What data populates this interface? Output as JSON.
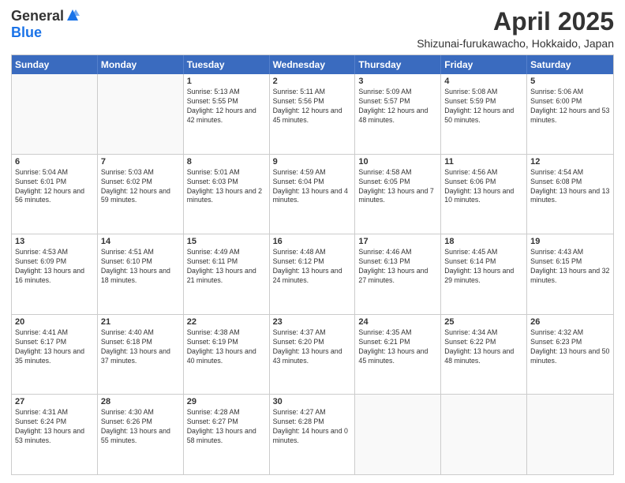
{
  "logo": {
    "general": "General",
    "blue": "Blue"
  },
  "header": {
    "month": "April 2025",
    "location": "Shizunai-furukawacho, Hokkaido, Japan"
  },
  "weekdays": [
    "Sunday",
    "Monday",
    "Tuesday",
    "Wednesday",
    "Thursday",
    "Friday",
    "Saturday"
  ],
  "rows": [
    [
      {
        "day": "",
        "detail": ""
      },
      {
        "day": "",
        "detail": ""
      },
      {
        "day": "1",
        "detail": "Sunrise: 5:13 AM\nSunset: 5:55 PM\nDaylight: 12 hours and 42 minutes."
      },
      {
        "day": "2",
        "detail": "Sunrise: 5:11 AM\nSunset: 5:56 PM\nDaylight: 12 hours and 45 minutes."
      },
      {
        "day": "3",
        "detail": "Sunrise: 5:09 AM\nSunset: 5:57 PM\nDaylight: 12 hours and 48 minutes."
      },
      {
        "day": "4",
        "detail": "Sunrise: 5:08 AM\nSunset: 5:59 PM\nDaylight: 12 hours and 50 minutes."
      },
      {
        "day": "5",
        "detail": "Sunrise: 5:06 AM\nSunset: 6:00 PM\nDaylight: 12 hours and 53 minutes."
      }
    ],
    [
      {
        "day": "6",
        "detail": "Sunrise: 5:04 AM\nSunset: 6:01 PM\nDaylight: 12 hours and 56 minutes."
      },
      {
        "day": "7",
        "detail": "Sunrise: 5:03 AM\nSunset: 6:02 PM\nDaylight: 12 hours and 59 minutes."
      },
      {
        "day": "8",
        "detail": "Sunrise: 5:01 AM\nSunset: 6:03 PM\nDaylight: 13 hours and 2 minutes."
      },
      {
        "day": "9",
        "detail": "Sunrise: 4:59 AM\nSunset: 6:04 PM\nDaylight: 13 hours and 4 minutes."
      },
      {
        "day": "10",
        "detail": "Sunrise: 4:58 AM\nSunset: 6:05 PM\nDaylight: 13 hours and 7 minutes."
      },
      {
        "day": "11",
        "detail": "Sunrise: 4:56 AM\nSunset: 6:06 PM\nDaylight: 13 hours and 10 minutes."
      },
      {
        "day": "12",
        "detail": "Sunrise: 4:54 AM\nSunset: 6:08 PM\nDaylight: 13 hours and 13 minutes."
      }
    ],
    [
      {
        "day": "13",
        "detail": "Sunrise: 4:53 AM\nSunset: 6:09 PM\nDaylight: 13 hours and 16 minutes."
      },
      {
        "day": "14",
        "detail": "Sunrise: 4:51 AM\nSunset: 6:10 PM\nDaylight: 13 hours and 18 minutes."
      },
      {
        "day": "15",
        "detail": "Sunrise: 4:49 AM\nSunset: 6:11 PM\nDaylight: 13 hours and 21 minutes."
      },
      {
        "day": "16",
        "detail": "Sunrise: 4:48 AM\nSunset: 6:12 PM\nDaylight: 13 hours and 24 minutes."
      },
      {
        "day": "17",
        "detail": "Sunrise: 4:46 AM\nSunset: 6:13 PM\nDaylight: 13 hours and 27 minutes."
      },
      {
        "day": "18",
        "detail": "Sunrise: 4:45 AM\nSunset: 6:14 PM\nDaylight: 13 hours and 29 minutes."
      },
      {
        "day": "19",
        "detail": "Sunrise: 4:43 AM\nSunset: 6:15 PM\nDaylight: 13 hours and 32 minutes."
      }
    ],
    [
      {
        "day": "20",
        "detail": "Sunrise: 4:41 AM\nSunset: 6:17 PM\nDaylight: 13 hours and 35 minutes."
      },
      {
        "day": "21",
        "detail": "Sunrise: 4:40 AM\nSunset: 6:18 PM\nDaylight: 13 hours and 37 minutes."
      },
      {
        "day": "22",
        "detail": "Sunrise: 4:38 AM\nSunset: 6:19 PM\nDaylight: 13 hours and 40 minutes."
      },
      {
        "day": "23",
        "detail": "Sunrise: 4:37 AM\nSunset: 6:20 PM\nDaylight: 13 hours and 43 minutes."
      },
      {
        "day": "24",
        "detail": "Sunrise: 4:35 AM\nSunset: 6:21 PM\nDaylight: 13 hours and 45 minutes."
      },
      {
        "day": "25",
        "detail": "Sunrise: 4:34 AM\nSunset: 6:22 PM\nDaylight: 13 hours and 48 minutes."
      },
      {
        "day": "26",
        "detail": "Sunrise: 4:32 AM\nSunset: 6:23 PM\nDaylight: 13 hours and 50 minutes."
      }
    ],
    [
      {
        "day": "27",
        "detail": "Sunrise: 4:31 AM\nSunset: 6:24 PM\nDaylight: 13 hours and 53 minutes."
      },
      {
        "day": "28",
        "detail": "Sunrise: 4:30 AM\nSunset: 6:26 PM\nDaylight: 13 hours and 55 minutes."
      },
      {
        "day": "29",
        "detail": "Sunrise: 4:28 AM\nSunset: 6:27 PM\nDaylight: 13 hours and 58 minutes."
      },
      {
        "day": "30",
        "detail": "Sunrise: 4:27 AM\nSunset: 6:28 PM\nDaylight: 14 hours and 0 minutes."
      },
      {
        "day": "",
        "detail": ""
      },
      {
        "day": "",
        "detail": ""
      },
      {
        "day": "",
        "detail": ""
      }
    ]
  ]
}
